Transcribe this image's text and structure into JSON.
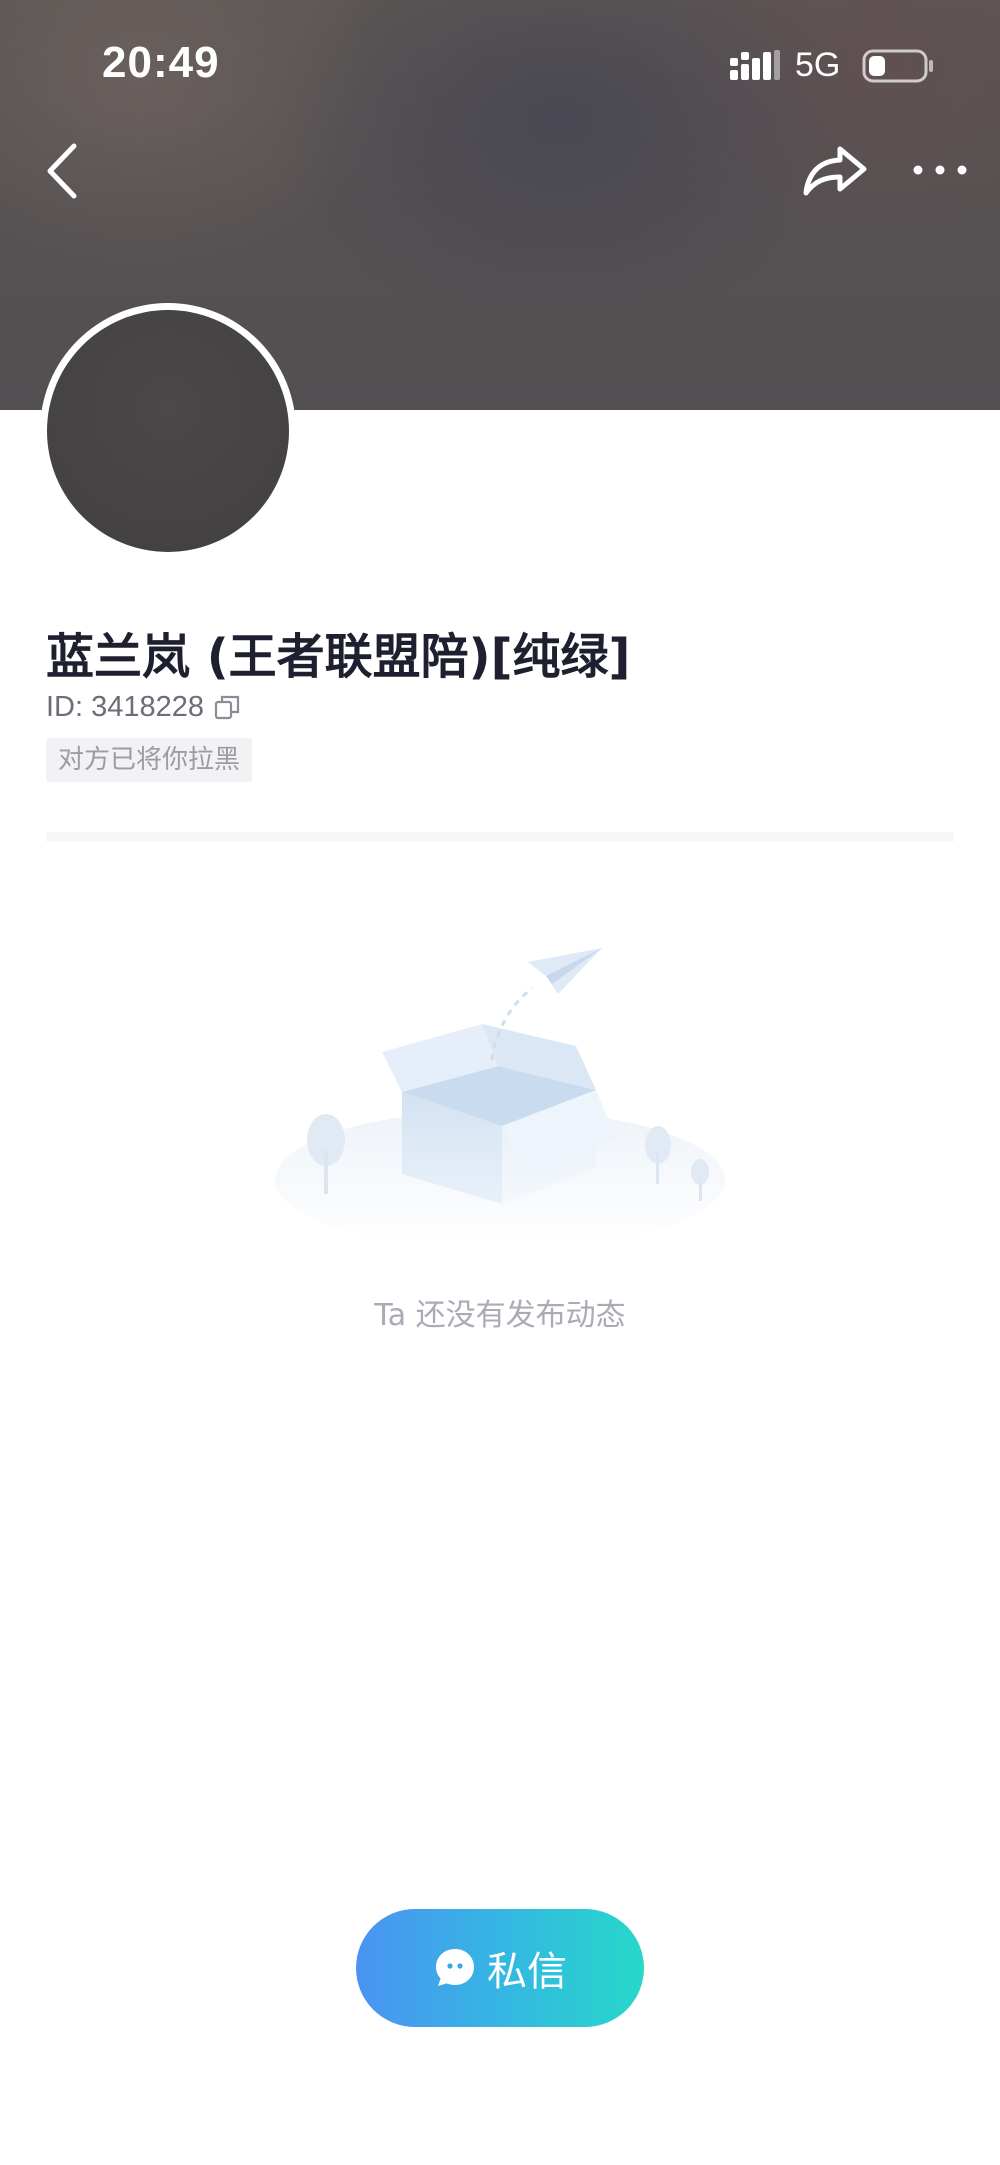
{
  "status_bar": {
    "time": "20:49",
    "network": "5G",
    "icons": [
      "signal-icon",
      "battery-icon"
    ]
  },
  "nav": {
    "icons": [
      "back-icon",
      "share-icon",
      "more-icon"
    ]
  },
  "profile": {
    "name": "蓝兰岚 (王者联盟陪)[纯绿]",
    "id_text": "ID: 3418228",
    "blocked_tag": "对方已将你拉黑"
  },
  "feed": {
    "empty_text": "Ta 还没有发布动态"
  },
  "actions": {
    "message_label": "私信"
  },
  "colors": {
    "name_text": "#1e2030",
    "muted_text": "#a9abb5",
    "button_gradient_start": "#4a93f1",
    "button_gradient_end": "#26d8c8"
  }
}
